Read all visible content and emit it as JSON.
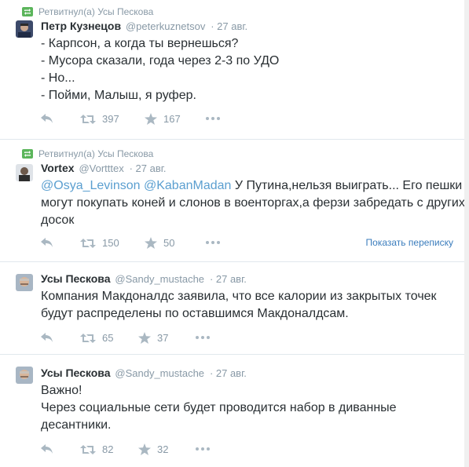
{
  "tweets": [
    {
      "retweeted_by": "Ретвитнул(а) Усы Пескова",
      "name": "Петр Кузнецов",
      "handle": "@peterkuznetsov",
      "time": "· 27 авг.",
      "lines": [
        "- Карпсон, а когда ты вернешься?",
        "- Мусора сказали, года через 2-3 по УДО",
        "- Но...",
        "- Пойми, Малыш, я руфер."
      ],
      "retweets": "397",
      "favorites": "167"
    },
    {
      "retweeted_by": "Ретвитнул(а) Усы Пескова",
      "name": "Vortex",
      "handle": "@Vortttex",
      "time": "· 27 авг.",
      "mention1": "@Osya_Levinson",
      "mention2": "@KabanMadan",
      "line1_rest": " У Путина,нельзя выиграть... Его пешки",
      "line2": "могут покупать коней и слонов в военторгах,а ферзи забредать с других",
      "line3": "досок",
      "retweets": "150",
      "favorites": "50",
      "show_conversation": "Показать переписку"
    },
    {
      "name": "Усы Пескова",
      "handle": "@Sandy_mustache",
      "time": "· 27 авг.",
      "lines": [
        "Компания Макдоналдс заявила, что все калории из закрытых точек",
        "будут распределены по оставшимся Макдоналдсам."
      ],
      "retweets": "65",
      "favorites": "37"
    },
    {
      "name": "Усы Пескова",
      "handle": "@Sandy_mustache",
      "time": "· 27 авг.",
      "lines": [
        "Важно!",
        "Через социальные сети будет проводится набор в диванные",
        "десантники."
      ],
      "retweets": "82",
      "favorites": "32"
    }
  ],
  "colors": {
    "accent": "#3b7dbd",
    "retweet_green": "#5bb55b",
    "muted": "#8899a6"
  },
  "icons": [
    "retweet-icon",
    "reply-icon",
    "star-icon",
    "more-icon"
  ]
}
